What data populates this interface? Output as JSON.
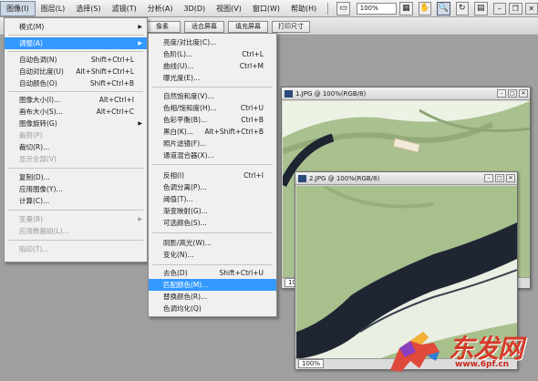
{
  "menubar": {
    "items": [
      "图像(I)",
      "图层(L)",
      "选择(S)",
      "滤镜(T)",
      "分析(A)",
      "3D(D)",
      "视图(V)",
      "窗口(W)",
      "帮助(H)"
    ],
    "zoom_value": "100%"
  },
  "options_bar": {
    "buttons": [
      "像素",
      "适合屏幕",
      "填充屏幕",
      "打印尺寸"
    ]
  },
  "image_menu": {
    "items": [
      {
        "label": "模式(M)",
        "shortcut": "",
        "submenu": true,
        "disabled": false
      },
      {
        "label": "调整(A)",
        "shortcut": "",
        "submenu": true,
        "disabled": false
      },
      {
        "label": "自动色调(N)",
        "shortcut": "Shift+Ctrl+L",
        "submenu": false,
        "disabled": false
      },
      {
        "label": "自动对比度(U)",
        "shortcut": "Alt+Shift+Ctrl+L",
        "submenu": false,
        "disabled": false
      },
      {
        "label": "自动颜色(O)",
        "shortcut": "Shift+Ctrl+B",
        "submenu": false,
        "disabled": false
      },
      {
        "label": "图像大小(I)...",
        "shortcut": "Alt+Ctrl+I",
        "submenu": false,
        "disabled": false
      },
      {
        "label": "画布大小(S)...",
        "shortcut": "Alt+Ctrl+C",
        "submenu": false,
        "disabled": false
      },
      {
        "label": "图像旋转(G)",
        "shortcut": "",
        "submenu": true,
        "disabled": false
      },
      {
        "label": "裁剪(P)",
        "shortcut": "",
        "submenu": false,
        "disabled": true
      },
      {
        "label": "裁切(R)...",
        "shortcut": "",
        "submenu": false,
        "disabled": false
      },
      {
        "label": "显示全部(V)",
        "shortcut": "",
        "submenu": false,
        "disabled": true
      },
      {
        "label": "复制(D)...",
        "shortcut": "",
        "submenu": false,
        "disabled": false
      },
      {
        "label": "应用图像(Y)...",
        "shortcut": "",
        "submenu": false,
        "disabled": false
      },
      {
        "label": "计算(C)...",
        "shortcut": "",
        "submenu": false,
        "disabled": false
      },
      {
        "label": "变量(B)",
        "shortcut": "",
        "submenu": true,
        "disabled": true
      },
      {
        "label": "应用数据组(L)...",
        "shortcut": "",
        "submenu": false,
        "disabled": true
      },
      {
        "label": "陷印(T)...",
        "shortcut": "",
        "submenu": false,
        "disabled": true
      }
    ]
  },
  "adjust_menu": {
    "items": [
      {
        "label": "亮度/对比度(C)...",
        "shortcut": ""
      },
      {
        "label": "色阶(L)...",
        "shortcut": "Ctrl+L"
      },
      {
        "label": "曲线(U)...",
        "shortcut": "Ctrl+M"
      },
      {
        "label": "曝光度(E)...",
        "shortcut": ""
      },
      {
        "label": "自然饱和度(V)...",
        "shortcut": ""
      },
      {
        "label": "色相/饱和度(H)...",
        "shortcut": "Ctrl+U"
      },
      {
        "label": "色彩平衡(B)...",
        "shortcut": "Ctrl+B"
      },
      {
        "label": "黑白(K)...",
        "shortcut": "Alt+Shift+Ctrl+B"
      },
      {
        "label": "照片滤镜(F)...",
        "shortcut": ""
      },
      {
        "label": "通道混合器(X)...",
        "shortcut": ""
      },
      {
        "label": "反相(I)",
        "shortcut": "Ctrl+I"
      },
      {
        "label": "色调分离(P)...",
        "shortcut": ""
      },
      {
        "label": "阈值(T)...",
        "shortcut": ""
      },
      {
        "label": "渐变映射(G)...",
        "shortcut": ""
      },
      {
        "label": "可选颜色(S)...",
        "shortcut": ""
      },
      {
        "label": "阴影/高光(W)...",
        "shortcut": ""
      },
      {
        "label": "变化(N)...",
        "shortcut": ""
      },
      {
        "label": "去色(D)",
        "shortcut": "Shift+Ctrl+U"
      },
      {
        "label": "匹配颜色(M)...",
        "shortcut": ""
      },
      {
        "label": "替换颜色(R)...",
        "shortcut": ""
      },
      {
        "label": "色调均化(Q)",
        "shortcut": ""
      }
    ],
    "highlighted": "匹配颜色(M)..."
  },
  "doc1": {
    "title": "1.JPG @ 100%(RGB/8)",
    "zoom": "100%"
  },
  "doc2": {
    "title": "2.JPG @ 100%(RGB/8)",
    "zoom": "100%"
  },
  "watermark": {
    "text": "东发网",
    "url": "www.6pf.cn"
  },
  "colors": {
    "highlight": "#3399ff",
    "menu_bg": "#f0f0f0",
    "fabric": "#a9c08f",
    "trim": "#1e2430"
  }
}
